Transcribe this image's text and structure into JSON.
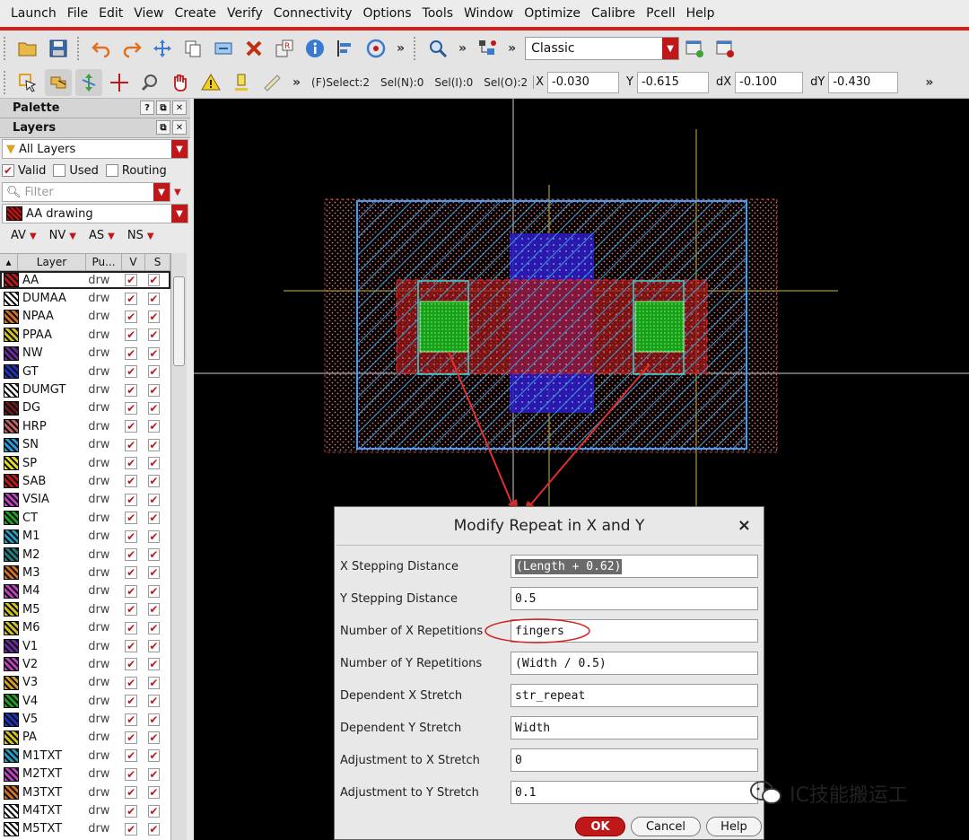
{
  "menu": [
    "Launch",
    "File",
    "Edit",
    "View",
    "Create",
    "Verify",
    "Connectivity",
    "Options",
    "Tools",
    "Window",
    "Optimize",
    "Calibre",
    "Pcell",
    "Help"
  ],
  "toolbar1": {
    "chevron": "»",
    "chevron2": "»",
    "chevron3": "»",
    "workspace": "Classic"
  },
  "toolbar2": {
    "chevron": "»",
    "status": [
      "(F)Select:2",
      "Sel(N):0",
      "Sel(I):0",
      "Sel(O):2"
    ],
    "x_label": "X",
    "x_value": "-0.030",
    "y_label": "Y",
    "y_value": "-0.615",
    "dx_label": "dX",
    "dx_value": "-0.100",
    "dy_label": "dY",
    "dy_value": "-0.430",
    "end_chevron": "»"
  },
  "palette": {
    "title": "Palette",
    "layers_title": "Layers",
    "filter_all": "All Layers",
    "valid": "Valid",
    "used": "Used",
    "routing": "Routing",
    "filter_placeholder": "Filter",
    "current_layer": "AA drawing",
    "visibility": [
      "AV",
      "NV",
      "AS",
      "NS"
    ],
    "columns": [
      "Layer",
      "Pu...",
      "V",
      "S"
    ],
    "check": "✔",
    "layers": [
      {
        "name": "AA",
        "purpose": "drw",
        "color": "#c01818"
      },
      {
        "name": "DUMAA",
        "purpose": "drw",
        "color": "#ffffff"
      },
      {
        "name": "NPAA",
        "purpose": "drw",
        "color": "#d07020"
      },
      {
        "name": "PPAA",
        "purpose": "drw",
        "color": "#d0c020"
      },
      {
        "name": "NW",
        "purpose": "drw",
        "color": "#6a2aa0"
      },
      {
        "name": "GT",
        "purpose": "drw",
        "color": "#2030c0"
      },
      {
        "name": "DUMGT",
        "purpose": "drw",
        "color": "#ffffff"
      },
      {
        "name": "DG",
        "purpose": "drw",
        "color": "#6a1a1a"
      },
      {
        "name": "HRP",
        "purpose": "drw",
        "color": "#c06060"
      },
      {
        "name": "SN",
        "purpose": "drw",
        "color": "#20a0e0"
      },
      {
        "name": "SP",
        "purpose": "drw",
        "color": "#e0e020"
      },
      {
        "name": "SAB",
        "purpose": "drw",
        "color": "#c01818"
      },
      {
        "name": "VSIA",
        "purpose": "drw",
        "color": "#c040c0"
      },
      {
        "name": "CT",
        "purpose": "drw",
        "color": "#20a020"
      },
      {
        "name": "M1",
        "purpose": "drw",
        "color": "#20a0c0"
      },
      {
        "name": "M2",
        "purpose": "drw",
        "color": "#208080"
      },
      {
        "name": "M3",
        "purpose": "drw",
        "color": "#d07020"
      },
      {
        "name": "M4",
        "purpose": "drw",
        "color": "#c040c0"
      },
      {
        "name": "M5",
        "purpose": "drw",
        "color": "#d0c020"
      },
      {
        "name": "M6",
        "purpose": "drw",
        "color": "#d0c020"
      },
      {
        "name": "V1",
        "purpose": "drw",
        "color": "#6a2aa0"
      },
      {
        "name": "V2",
        "purpose": "drw",
        "color": "#c040c0"
      },
      {
        "name": "V3",
        "purpose": "drw",
        "color": "#d0a020"
      },
      {
        "name": "V4",
        "purpose": "drw",
        "color": "#20a020"
      },
      {
        "name": "V5",
        "purpose": "drw",
        "color": "#2030c0"
      },
      {
        "name": "PA",
        "purpose": "drw",
        "color": "#d0c020"
      },
      {
        "name": "M1TXT",
        "purpose": "drw",
        "color": "#20a0c0"
      },
      {
        "name": "M2TXT",
        "purpose": "drw",
        "color": "#c040c0"
      },
      {
        "name": "M3TXT",
        "purpose": "drw",
        "color": "#d07020"
      },
      {
        "name": "M4TXT",
        "purpose": "drw",
        "color": "#ffffff"
      },
      {
        "name": "M5TXT",
        "purpose": "drw",
        "color": "#ffffff"
      }
    ]
  },
  "dialog": {
    "title": "Modify Repeat in X and Y",
    "close": "×",
    "fields": [
      {
        "label": "X Stepping Distance",
        "value": "(Length + 0.62)"
      },
      {
        "label": "Y Stepping Distance",
        "value": "0.5"
      },
      {
        "label": "Number of X Repetitions",
        "value": "fingers"
      },
      {
        "label": "Number of Y Repetitions",
        "value": "(Width / 0.5)"
      },
      {
        "label": "Dependent X Stretch",
        "value": "str_repeat"
      },
      {
        "label": "Dependent Y Stretch",
        "value": "Width"
      },
      {
        "label": "Adjustment to X Stretch",
        "value": "0"
      },
      {
        "label": "Adjustment to Y Stretch",
        "value": "0.1"
      }
    ],
    "ok": "OK",
    "cancel": "Cancel",
    "help": "Help"
  },
  "watermark": "IC技能搬运工",
  "colors": {
    "accent": "#c01818",
    "canvas": "#000000"
  }
}
